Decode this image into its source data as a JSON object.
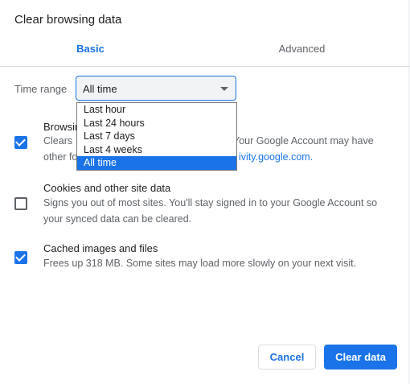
{
  "dialog": {
    "title": "Clear browsing data"
  },
  "tabs": [
    {
      "label": "Basic"
    },
    {
      "label": "Advanced"
    }
  ],
  "time_range": {
    "label": "Time range",
    "selected": "All time",
    "options": [
      "Last hour",
      "Last 24 hours",
      "Last 7 days",
      "Last 4 weeks",
      "All time"
    ]
  },
  "items": [
    {
      "title": "Browsin",
      "desc_line1_left": "Clears",
      "desc_line1_right": "Your Google Account may have",
      "desc_line2_left": "other fo",
      "desc_line2_right": "ivity.google.com.",
      "checked": true
    },
    {
      "title": "Cookies and other site data",
      "desc": "Signs you out of most sites. You'll stay signed in to your Google Account so your synced data can be cleared.",
      "checked": false
    },
    {
      "title": "Cached images and files",
      "desc": "Frees up 318 MB. Some sites may load more slowly on your next visit.",
      "checked": true
    }
  ],
  "buttons": {
    "cancel": "Cancel",
    "clear": "Clear data"
  },
  "colors": {
    "accent": "#1a73e8",
    "text": "#202124",
    "secondary_text": "#5f6368"
  }
}
